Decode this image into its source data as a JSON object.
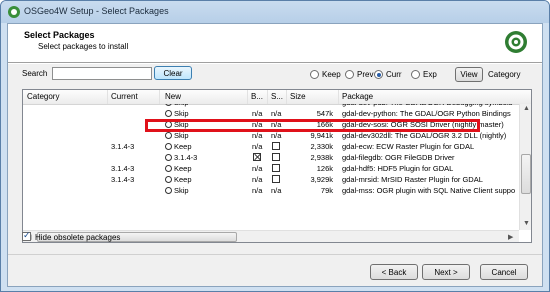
{
  "window": {
    "title": "OSGeo4W Setup - Select Packages"
  },
  "header": {
    "title": "Select Packages",
    "subtitle": "Select packages to install"
  },
  "search": {
    "label": "Search",
    "value": "",
    "clear_label": "Clear"
  },
  "view_modes": {
    "keep": "Keep",
    "prev": "Prev",
    "curr": "Curr",
    "exp": "Exp",
    "selected": "curr",
    "view_button": "View",
    "current_view": "Category"
  },
  "columns": {
    "category": "Category",
    "current": "Current",
    "new": "New",
    "bin": "B...",
    "src": "S...",
    "size": "Size",
    "package": "Package"
  },
  "rows": [
    {
      "current": "",
      "new": "Skip",
      "bin": "",
      "src": "",
      "size": "",
      "package": "gdal-dev-pdb: The GDAL/OGR Debugging symbols"
    },
    {
      "current": "",
      "new": "Skip",
      "bin": "n/a",
      "src": "n/a",
      "size": "547k",
      "package": "gdal-dev-python: The GDAL/OGR Python Bindings"
    },
    {
      "current": "",
      "new": "Skip",
      "bin": "n/a",
      "src": "n/a",
      "size": "166k",
      "package": "gdal-dev-sosi: OGR SOSI Driver (nightly master)"
    },
    {
      "current": "",
      "new": "Skip",
      "bin": "n/a",
      "src": "n/a",
      "size": "9,941k",
      "package": "gdal-dev302dll: The GDAL/OGR 3.2 DLL (nightly)"
    },
    {
      "current": "3.1.4-3",
      "new": "Keep",
      "bin": "n/a",
      "src": "",
      "size": "2,330k",
      "package": "gdal-ecw: ECW Raster Plugin for GDAL"
    },
    {
      "current": "",
      "new": "3.1.4-3",
      "bin": "x",
      "src": "",
      "size": "2,938k",
      "package": "gdal-filegdb: OGR FileGDB Driver"
    },
    {
      "current": "3.1.4-3",
      "new": "Keep",
      "bin": "n/a",
      "src": "",
      "size": "126k",
      "package": "gdal-hdf5: HDF5 Plugin for GDAL"
    },
    {
      "current": "3.1.4-3",
      "new": "Keep",
      "bin": "n/a",
      "src": "",
      "size": "3,929k",
      "package": "gdal-mrsid: MrSID Raster Plugin for GDAL"
    },
    {
      "current": "",
      "new": "Skip",
      "bin": "n/a",
      "src": "n/a",
      "size": "79k",
      "package": "gdal-mss: OGR plugin with SQL Native Client suppo"
    }
  ],
  "options": {
    "hide_obsolete_label": "Hide obsolete packages",
    "hide_obsolete_checked": true
  },
  "buttons": {
    "back": "< Back",
    "next": "Next >",
    "cancel": "Cancel"
  },
  "icons": {
    "app": "osgeo-icon",
    "logo": "osgeo4w-logo",
    "row": "cycle-icon"
  },
  "colors": {
    "highlight": "#e0111a"
  }
}
